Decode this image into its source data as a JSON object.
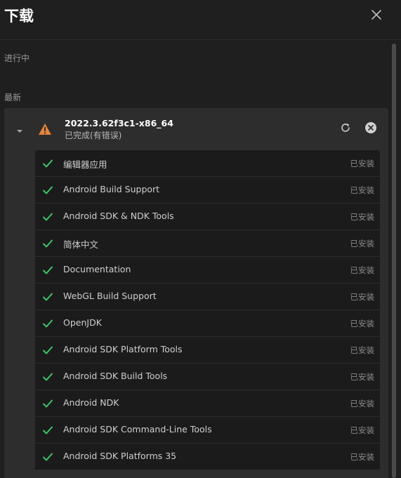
{
  "header": {
    "title": "下载"
  },
  "sections": {
    "in_progress_label": "进行中",
    "latest_label": "最新"
  },
  "download": {
    "version": "2022.3.62f3c1-x86_64",
    "status": "已完成(有错误)",
    "modules": [
      {
        "name": "编辑器应用",
        "state": "已安装"
      },
      {
        "name": "Android Build Support",
        "state": "已安装"
      },
      {
        "name": "Android SDK & NDK Tools",
        "state": "已安装"
      },
      {
        "name": "简体中文",
        "state": "已安装"
      },
      {
        "name": "Documentation",
        "state": "已安装"
      },
      {
        "name": "WebGL Build Support",
        "state": "已安装"
      },
      {
        "name": "OpenJDK",
        "state": "已安装"
      },
      {
        "name": "Android SDK Platform Tools",
        "state": "已安装"
      },
      {
        "name": "Android SDK Build Tools",
        "state": "已安装"
      },
      {
        "name": "Android NDK",
        "state": "已安装"
      },
      {
        "name": "Android SDK Command-Line Tools",
        "state": "已安装"
      },
      {
        "name": "Android SDK Platforms 35",
        "state": "已安装"
      }
    ]
  },
  "colors": {
    "success_check": "#3ec46d",
    "warning": "#e8833a",
    "panel_bg": "#1f1f1f",
    "card_bg": "#2d2d2d",
    "row_bg": "#1b1b1b"
  },
  "icons": {
    "close": "close-icon",
    "collapse": "chevron-down-icon",
    "warning": "warning-icon",
    "refresh": "refresh-icon",
    "remove": "close-circle-icon",
    "check": "check-icon"
  }
}
